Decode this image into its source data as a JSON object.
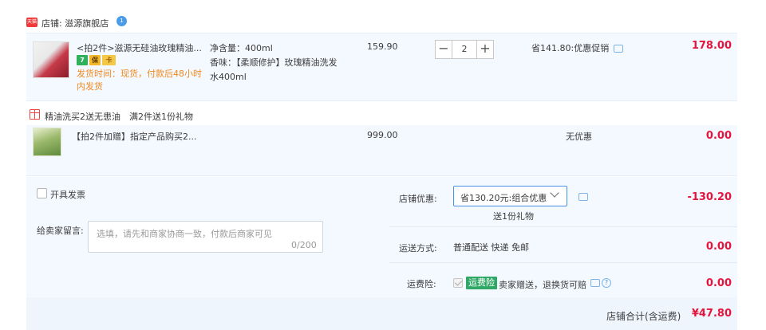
{
  "shop": {
    "badge": "天猫",
    "label": "店铺: 滋源旗舰店",
    "ww_badge": "1"
  },
  "items": [
    {
      "title": "<拍2件>滋源无硅油玫瑰精油...",
      "tags": [
        "7",
        "保",
        "卡"
      ],
      "ship_note": "发货时间：现货，付款后48小时内发货",
      "sku_line1": "净含量：400ml",
      "sku_line2": "香味：【柔顺修护】玫瑰精油洗发水400ml",
      "price": "159.90",
      "quantity": "2",
      "promo": "省141.80:优惠促销",
      "total": "178.00"
    },
    {
      "title": "【拍2件加赠】指定产品购买2...",
      "price": "999.00",
      "promo": "无优惠",
      "total": "0.00"
    }
  ],
  "gift_promo": "精油洗买2送无患油　满2件送1份礼物",
  "qty_controls": {
    "minus": "−",
    "plus": "+"
  },
  "invoice": {
    "label": "开具发票"
  },
  "message": {
    "label": "给卖家留言:",
    "placeholder": "选填，请先和商家协商一致，付款后商家可见",
    "count": "0/200"
  },
  "shop_discount": {
    "label": "店铺优惠:",
    "selected": "省130.20元:组合优惠",
    "gift_note": "送1份礼物",
    "amount": "-130.20"
  },
  "shipping": {
    "label": "运送方式:",
    "method": "普通配送 快递 免邮",
    "amount": "0.00"
  },
  "insurance": {
    "label": "运费险:",
    "badge": "运费险",
    "text": "卖家赠送，退换货可赔",
    "help": "?",
    "amount": "0.00"
  },
  "grand_total": {
    "label": "店铺合计(含运费)",
    "value": "¥47.80"
  },
  "colors": {
    "price_red": "#e4153c",
    "accent_blue": "#4a90e2",
    "ship_orange": "#ef8a20",
    "row_bg": "#f4f9ff"
  }
}
